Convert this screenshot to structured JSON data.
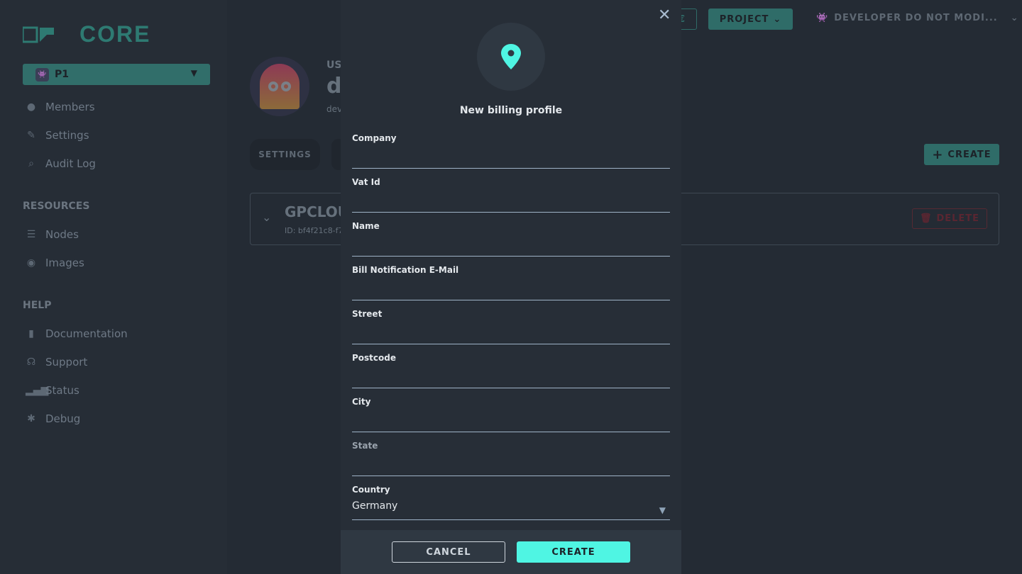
{
  "brand": {
    "logo_text": "CORE"
  },
  "sidebar": {
    "project": {
      "label": "P1"
    },
    "items": [
      {
        "label": "Members",
        "icon": "user-icon"
      },
      {
        "label": "Settings",
        "icon": "wrench-icon"
      },
      {
        "label": "Audit Log",
        "icon": "search-icon"
      }
    ],
    "resources_title": "RESOURCES",
    "resources": [
      {
        "label": "Nodes",
        "icon": "server-icon"
      },
      {
        "label": "Images",
        "icon": "disc-icon"
      }
    ],
    "help_title": "HELP",
    "help": [
      {
        "label": "Documentation",
        "icon": "book-icon"
      },
      {
        "label": "Support",
        "icon": "headset-icon"
      },
      {
        "label": "Status",
        "icon": "signal-icon"
      },
      {
        "label": "Debug",
        "icon": "bug-icon"
      }
    ]
  },
  "header": {
    "currency_partial": "€",
    "project_label": "PROJECT",
    "user_label": "DEVELOPER DO NOT MODI..."
  },
  "main": {
    "user_caption_partial": "US",
    "user_name_partial": "d",
    "user_sub_partial": "dev",
    "tab_settings": "SETTINGS",
    "create_label": "CREATE",
    "card_title_partial": "GPCLOU",
    "card_id_partial": "ID: bf4f21c8-f7",
    "delete_label": "DELETE"
  },
  "modal": {
    "title": "New billing profile",
    "icon": "map-pin-icon",
    "fields": [
      {
        "label": "Company",
        "value": ""
      },
      {
        "label": "Vat Id",
        "value": ""
      },
      {
        "label": "Name",
        "value": ""
      },
      {
        "label": "Bill Notification E-Mail",
        "value": ""
      },
      {
        "label": "Street",
        "value": ""
      },
      {
        "label": "Postcode",
        "value": ""
      },
      {
        "label": "City",
        "value": ""
      },
      {
        "label": "State",
        "value": ""
      }
    ],
    "country": {
      "label": "Country",
      "value": "Germany"
    },
    "cancel_label": "CANCEL",
    "create_label": "CREATE"
  },
  "colors": {
    "accent": "#4ff5e3",
    "teal_dimmed": "#2f6c68",
    "danger_dimmed": "#552a33"
  }
}
